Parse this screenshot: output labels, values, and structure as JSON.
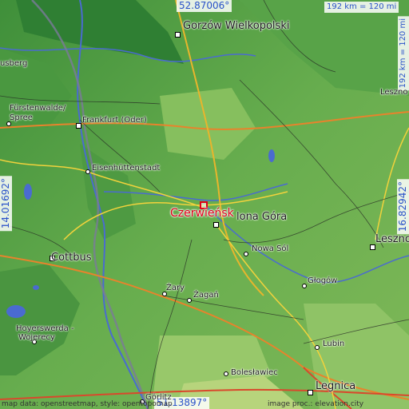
{
  "map": {
    "main_place": "Czerwieńsk",
    "coords": {
      "top": "52.87006°",
      "bottom": "51.13897°",
      "left": "14.01692°",
      "right": "16.82942°"
    },
    "scale_top": "192 km = 120 mi",
    "scale_right": "192 km = 120 mi",
    "attribution_left": "map data: openstreetmap, style: opentopomap",
    "attribution_right": "image proc.: elevation.city",
    "places": {
      "gorzow": "Gorzów Wielkopolski",
      "zielona_gora": "lona Góra",
      "frankfurt": "Frankfurt (Oder)",
      "furstenwalde": "Fürstenwalde/",
      "spree": "Spree",
      "eisenhuttenstadt": "Eisenhüttenstadt",
      "cottbus": "Cottbus",
      "nowa_sol": "Nowa Sól",
      "leszno": "Leszno",
      "glogow": "Głogów",
      "zary": "Żary",
      "zagan": "Żagań",
      "hoyerswerda": "Hoyerswerda -",
      "wojerecy": "Wojerecy",
      "lubin": "Lubin",
      "boleslawiec": "Bolesławiec",
      "legnica": "Legnica",
      "gorlitz": "Görlitz",
      "usberg": "usberg",
      "leszno_partial": "Leszno"
    }
  }
}
